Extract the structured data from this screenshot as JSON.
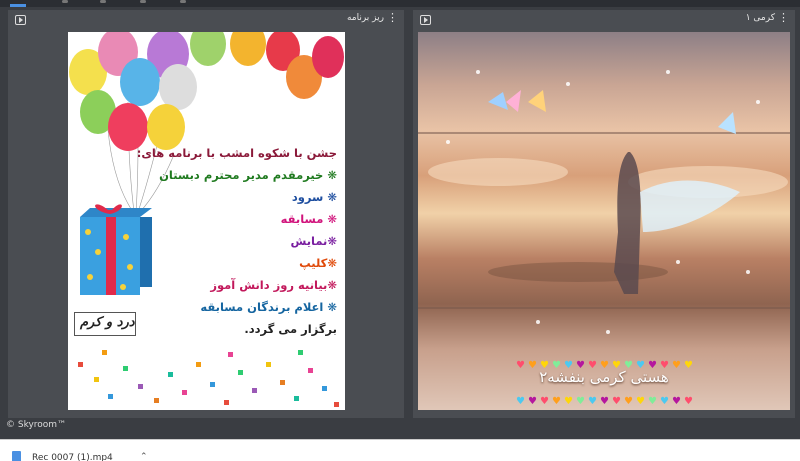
{
  "left_panel": {
    "title": "ریز برنامه",
    "slide": {
      "lines": [
        {
          "text": "جشن با شکوه امشب با برنامه های:",
          "color": "#8b1a3a"
        },
        {
          "text": "❋ خیرمقدم مدیر محترم دبستان",
          "color": "#1f7a1f"
        },
        {
          "text": "❋ سرود",
          "color": "#1f4fa0"
        },
        {
          "text": "❋ مسابقه",
          "color": "#d1147c"
        },
        {
          "text": "❋نمایش",
          "color": "#7a1fa0"
        },
        {
          "text": "❋کلیپ",
          "color": "#e04a0a"
        },
        {
          "text": "❋بیانیه روز دانش آموز",
          "color": "#c2185b"
        },
        {
          "text": "❋ اعلام برندگان مسابقه",
          "color": "#1565a0"
        },
        {
          "text": "برگزار می گردد.",
          "color": "#222222"
        }
      ],
      "logo_text": "درد و کرم"
    }
  },
  "right_panel": {
    "title": "کرمی ۱",
    "caption": "هستی کرمی بنفشه۲"
  },
  "footer": {
    "brand": "© Skyroom™"
  },
  "download": {
    "file_name": "Rec 0007 (1).mp4"
  }
}
